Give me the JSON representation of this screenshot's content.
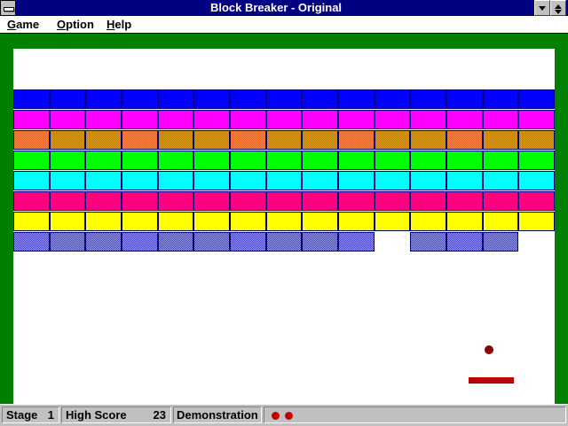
{
  "window": {
    "title": "Block Breaker - Original"
  },
  "menu": [
    "Game",
    "Option",
    "Help"
  ],
  "colors": {
    "frame": "#008000",
    "ball": "#8b0000",
    "paddle": "#c00000",
    "life": "#c00000"
  },
  "bricks": {
    "columns": 15,
    "rows": [
      {
        "color": "#0000ff",
        "pattern": "solid"
      },
      {
        "color": "#ff00ff",
        "pattern": "solid"
      },
      {
        "color": "#ff8040",
        "pattern": "dither",
        "alt": "#c08000"
      },
      {
        "color": "#00ff00",
        "pattern": "solid"
      },
      {
        "color": "#00ffff",
        "pattern": "solid"
      },
      {
        "color": "#ff0080",
        "pattern": "solid"
      },
      {
        "color": "#ffff00",
        "pattern": "solid"
      },
      {
        "color": "#a0a0ff",
        "pattern": "dither",
        "alt": "#4040c0",
        "present": [
          1,
          1,
          1,
          1,
          1,
          1,
          1,
          1,
          1,
          1,
          0,
          1,
          1,
          1,
          0
        ]
      }
    ]
  },
  "status": {
    "stage_label": "Stage",
    "stage_value": "1",
    "high_score_label": "High Score",
    "high_score_value": "23",
    "mode": "Demonstration",
    "lives": 2
  }
}
